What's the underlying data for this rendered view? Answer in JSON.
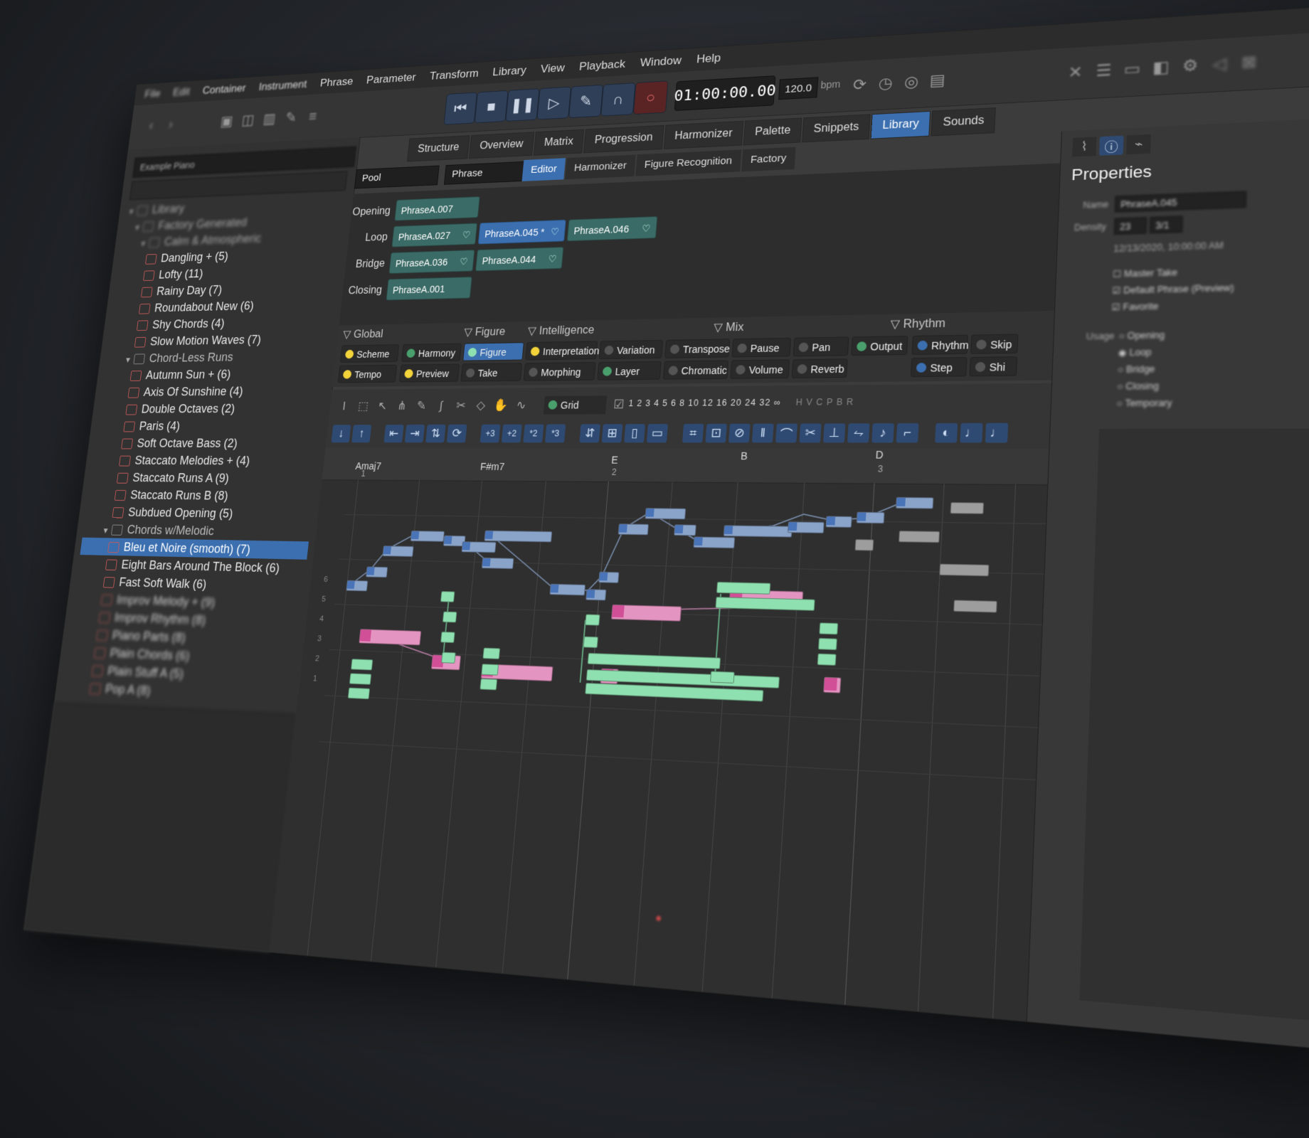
{
  "menu": [
    "File",
    "Edit",
    "Container",
    "Instrument",
    "Phrase",
    "Parameter",
    "Transform",
    "Library",
    "View",
    "Playback",
    "Window",
    "Help"
  ],
  "transport": {
    "timecode": "01:00:00.00",
    "tempo": "120.0",
    "tempo_unit": "bpm"
  },
  "main_tabs": [
    "Structure",
    "Overview",
    "Matrix",
    "Progression",
    "Harmonizer",
    "Palette",
    "Snippets",
    "Library",
    "Sounds"
  ],
  "active_main_tab": "Library",
  "left": {
    "instrument_select": "Example Piano",
    "tree": [
      {
        "label": "Library",
        "type": "folder",
        "level": 0
      },
      {
        "label": "Factory Generated",
        "type": "folder",
        "level": 1
      },
      {
        "label": "Calm & Atmospheric",
        "type": "folder",
        "level": 2
      },
      {
        "label": "Dangling + (5)",
        "type": "item",
        "level": 3
      },
      {
        "label": "Lofty (11)",
        "type": "item",
        "level": 3
      },
      {
        "label": "Rainy Day (7)",
        "type": "item",
        "level": 3
      },
      {
        "label": "Roundabout New (6)",
        "type": "item",
        "level": 3
      },
      {
        "label": "Shy Chords (4)",
        "type": "item",
        "level": 3
      },
      {
        "label": "Slow Motion Waves (7)",
        "type": "item",
        "level": 3
      },
      {
        "label": "Chord-Less Runs",
        "type": "folder",
        "level": 2
      },
      {
        "label": "Autumn Sun + (6)",
        "type": "item",
        "level": 3
      },
      {
        "label": "Axis Of Sunshine (4)",
        "type": "item",
        "level": 3
      },
      {
        "label": "Double Octaves (2)",
        "type": "item",
        "level": 3
      },
      {
        "label": "Paris (4)",
        "type": "item",
        "level": 3
      },
      {
        "label": "Soft Octave Bass (2)",
        "type": "item",
        "level": 3
      },
      {
        "label": "Staccato Melodies + (4)",
        "type": "item",
        "level": 3
      },
      {
        "label": "Staccato Runs A (9)",
        "type": "item",
        "level": 3
      },
      {
        "label": "Staccato Runs B (8)",
        "type": "item",
        "level": 3
      },
      {
        "label": "Subdued Opening (5)",
        "type": "item",
        "level": 3
      },
      {
        "label": "Chords w/Melodic",
        "type": "folder",
        "level": 2
      },
      {
        "label": "Bleu et Noire (smooth) (7)",
        "type": "item",
        "level": 3,
        "selected": true
      },
      {
        "label": "Eight Bars Around The Block (6)",
        "type": "item",
        "level": 3
      },
      {
        "label": "Fast Soft Walk (6)",
        "type": "item",
        "level": 3
      },
      {
        "label": "Improv Melody + (9)",
        "type": "item",
        "level": 3
      },
      {
        "label": "Improv Rhythm (8)",
        "type": "item",
        "level": 3
      },
      {
        "label": "Piano Parts (8)",
        "type": "item",
        "level": 3
      },
      {
        "label": "Plain Chords (6)",
        "type": "item",
        "level": 3
      },
      {
        "label": "Plain Stuff A (5)",
        "type": "item",
        "level": 3
      },
      {
        "label": "Pop A (8)",
        "type": "item",
        "level": 3
      }
    ]
  },
  "editor": {
    "pool_select": "Pool",
    "phrase_select": "Phrase",
    "sub_tabs": [
      "Editor",
      "Harmonizer",
      "Figure Recognition",
      "Factory"
    ],
    "active_sub_tab": "Editor",
    "phrase_rows": [
      {
        "label": "Opening",
        "phrases": [
          "PhraseA.007"
        ]
      },
      {
        "label": "Loop",
        "phrases": [
          "PhraseA.027",
          "PhraseA.045 *",
          "PhraseA.046"
        ]
      },
      {
        "label": "Bridge",
        "phrases": [
          "PhraseA.036",
          "PhraseA.044"
        ]
      },
      {
        "label": "Closing",
        "phrases": [
          "PhraseA.001"
        ]
      }
    ],
    "section_headers": [
      "Global",
      "Figure",
      "Intelligence",
      "Mix",
      "Rhythm"
    ],
    "chips": {
      "scheme": "Scheme",
      "tempo": "Tempo",
      "harmony": "Harmony",
      "preview": "Preview",
      "figure": "Figure",
      "take": "Take",
      "interpretation": "Interpretation",
      "morphing": "Morphing",
      "variation": "Variation",
      "layer": "Layer",
      "transpose": "Transpose",
      "chromatic": "Chromatic",
      "pause": "Pause",
      "volume": "Volume",
      "pan": "Pan",
      "reverb": "Reverb",
      "output": "Output",
      "rhythm": "Rhythm",
      "step": "Step",
      "skip": "Skip",
      "shift": "Shi"
    },
    "grid_label": "Grid",
    "grid_values": "1 2 3 4 5 6 8 10 12 16 20 24 32 ∞",
    "hvcpbr": "H V C P B R",
    "transpose_buttons": [
      "+3",
      "+2",
      "*2",
      "*3"
    ],
    "chords": [
      "Amaj7",
      "F#m7",
      "E",
      "B",
      "D"
    ],
    "bars": [
      "1",
      "2",
      "3"
    ],
    "row_numbers": [
      "6",
      "5",
      "4",
      "3",
      "2",
      "1"
    ]
  },
  "properties": {
    "title": "Properties",
    "name_label": "Name",
    "name_value": "PhraseA.045",
    "density_label": "Density",
    "density_values": [
      "23",
      "3/1"
    ],
    "date": "12/13/2020, 10:00:00 AM",
    "checks": [
      "Master Take",
      "Default Phrase (Preview)",
      "Favorite"
    ],
    "usage_label": "Usage",
    "usage_options": [
      "Opening",
      "Loop",
      "Bridge",
      "Closing",
      "Temporary"
    ]
  },
  "colors": {
    "accent": "#3b6fb0",
    "phrase_chip": "#3b6b66",
    "note_blue": "#8aa3c8",
    "note_green": "#8fe0b0",
    "note_pink": "#e394c0",
    "record": "#e46a6a"
  }
}
